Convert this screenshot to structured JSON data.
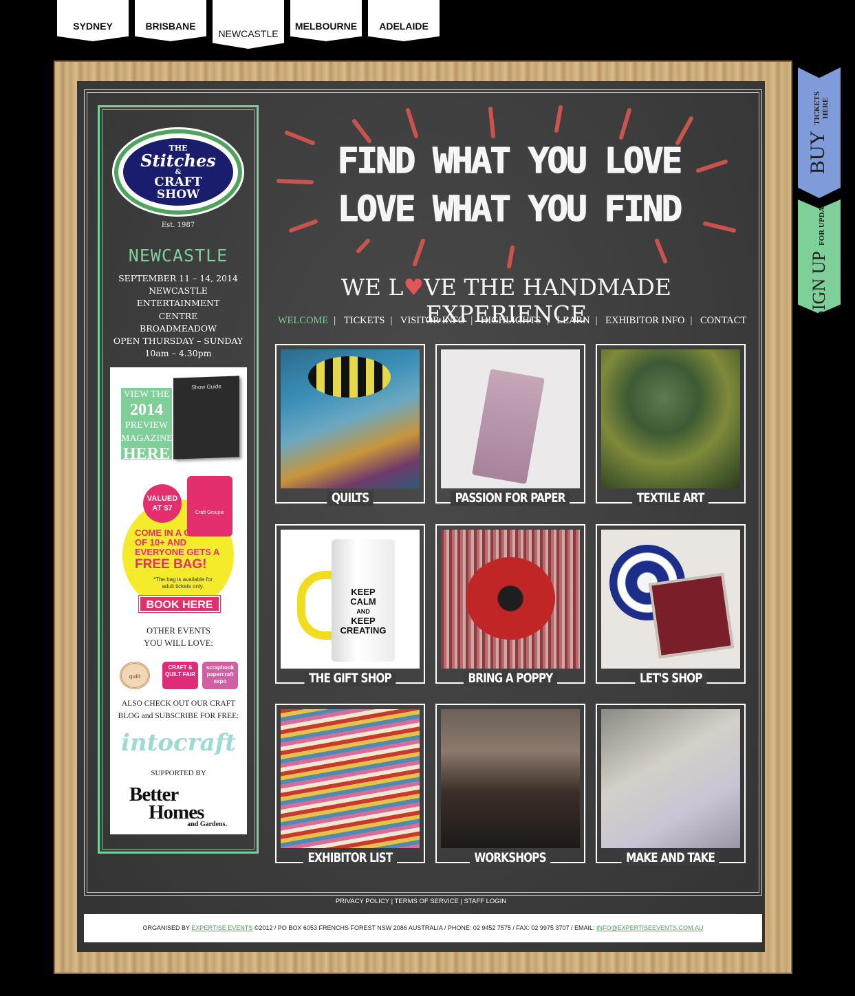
{
  "city_tabs": [
    {
      "label": "SYDNEY"
    },
    {
      "label": "BRISBANE"
    },
    {
      "label": "NEWCASTLE",
      "active": true
    },
    {
      "label": "MELBOURNE"
    },
    {
      "label": "ADELAIDE"
    }
  ],
  "sidebar": {
    "logo": {
      "line1": "THE",
      "line2": "Stitches",
      "line3": "&",
      "line4": "CRAFT",
      "line5": "SHOW",
      "est": "Est. 1987"
    },
    "city": "NEWCASTLE",
    "event_lines": [
      "SEPTEMBER 11 – 14, 2014",
      "NEWCASTLE",
      "ENTERTAINMENT",
      "CENTRE",
      "BROADMEADOW",
      "OPEN THURSDAY – SUNDAY",
      "10am – 4.30pm"
    ],
    "promo": {
      "mag": {
        "l1": "VIEW THE",
        "l2": "2014",
        "l3": "PREVIEW",
        "l4": "MAGAZINE",
        "l5": "HERE",
        "cover": "Show Guide"
      },
      "valued": "VALUED AT $7",
      "bag_label": "Craft Groupie",
      "group_text": "COME IN A GROUP OF 10+ AND EVERYONE GETS A",
      "free_bag": "FREE BAG!",
      "note": "*The bag is available for adult tickets only.",
      "book": "BOOK HERE",
      "other_l1": "OTHER EVENTS",
      "other_l2": "YOU WILL LOVE:",
      "events": [
        {
          "label": "quilt"
        },
        {
          "label": "CRAFT & QUILT FAIR"
        },
        {
          "label": "scrapbook papercraft expo"
        }
      ],
      "blog_l1": "ALSO CHECK OUT OUR CRAFT",
      "blog_l2": "BLOG and SUBSCRIBE FOR FREE:",
      "intocraft": "intocraft",
      "supported": "SUPPORTED BY",
      "bhg_l1": "Better",
      "bhg_l2": "Homes",
      "bhg_l3": "and Gardens."
    }
  },
  "sashes": {
    "buy": {
      "big": "BUY",
      "small_l1": "TICKETS",
      "small_l2": "HERE"
    },
    "sign": {
      "big": "SIGN UP",
      "small_l1": "FOR UPDATES"
    }
  },
  "headline": {
    "l1": "FIND WHAT YOU LOVE",
    "l2": "LOVE WHAT YOU FIND"
  },
  "tagline": {
    "before": "WE L",
    "heart": "♥",
    "after": "VE THE HANDMADE EXPERIENCE"
  },
  "nav": [
    {
      "label": "WELCOME",
      "active": true
    },
    {
      "label": "TICKETS"
    },
    {
      "label": "VISITOR INFO"
    },
    {
      "label": "HIGHLIGHTS"
    },
    {
      "label": "LEARN"
    },
    {
      "label": "EXHIBITOR INFO"
    },
    {
      "label": "CONTACT"
    }
  ],
  "tiles": [
    {
      "label": "QUILTS"
    },
    {
      "label": "PASSION FOR PAPER"
    },
    {
      "label": "TEXTILE ART"
    },
    {
      "label": "THE GIFT SHOP"
    },
    {
      "label": "BRING A POPPY"
    },
    {
      "label": "LET'S SHOP"
    },
    {
      "label": "EXHIBITOR LIST"
    },
    {
      "label": "WORKSHOPS"
    },
    {
      "label": "MAKE AND TAKE"
    }
  ],
  "mug_text": {
    "l1": "KEEP",
    "l2": "CALM",
    "l3": "AND",
    "l4": "KEEP",
    "l5": "CREATING"
  },
  "footer": {
    "links": [
      {
        "label": "PRIVACY POLICY"
      },
      {
        "label": "TERMS OF SERVICE"
      },
      {
        "label": "STAFF LOGIN"
      }
    ],
    "org_prefix": "ORGANISED BY",
    "org_link": "EXPERTISE EVENTS",
    "org_text": "©2012 / PO BOX 6053 FRENCHS FOREST NSW 2086 AUSTRALIA / PHONE: 02 9452 7575 / FAX: 02 9975 3707 / EMAIL:",
    "email": "INFO@EXPERTISEEVENTS.COM.AU"
  },
  "colors": {
    "chalk_green": "#7fcf99",
    "pink": "#e42f6e",
    "blue_sash": "#7f9bd9",
    "board": "#3c3c3c"
  }
}
